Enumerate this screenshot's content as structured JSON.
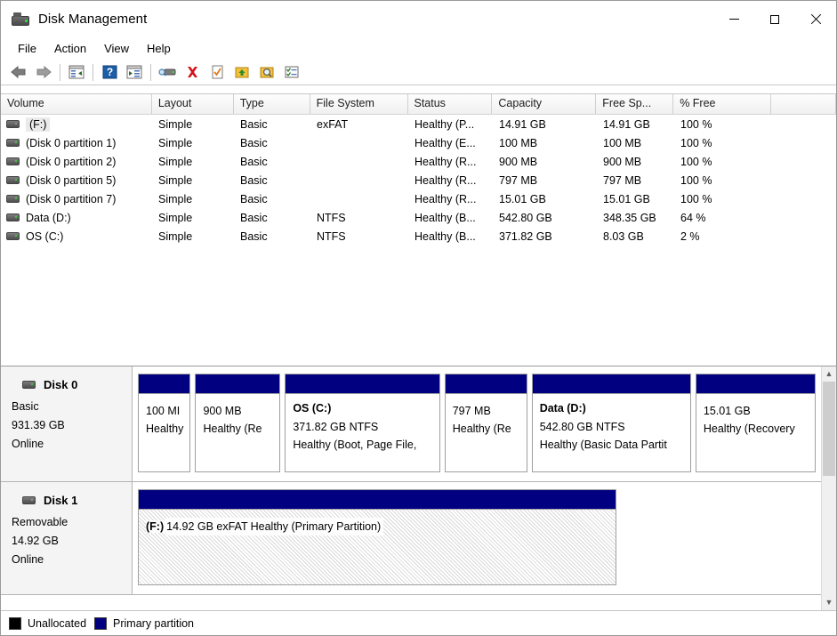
{
  "window": {
    "title": "Disk Management",
    "icon": "disk-management-icon",
    "controls": {
      "minimize": "minimize-icon",
      "maximize": "maximize-icon",
      "close": "close-icon"
    }
  },
  "menubar": {
    "items": [
      {
        "label": "File"
      },
      {
        "label": "Action"
      },
      {
        "label": "View"
      },
      {
        "label": "Help"
      }
    ]
  },
  "toolbar": {
    "buttons": [
      {
        "name": "back-icon"
      },
      {
        "name": "forward-icon"
      },
      {
        "name": "show-hide-console-tree-icon"
      },
      {
        "name": "help-icon"
      },
      {
        "name": "show-hide-action-pane-icon"
      },
      {
        "name": "rescan-disks-icon"
      },
      {
        "name": "delete-volume-icon"
      },
      {
        "name": "properties-icon"
      },
      {
        "name": "extend-volume-icon"
      },
      {
        "name": "search-icon"
      },
      {
        "name": "options-icon"
      }
    ]
  },
  "volume_table": {
    "columns": [
      {
        "label": "Volume",
        "width": 170
      },
      {
        "label": "Layout",
        "width": 92
      },
      {
        "label": "Type",
        "width": 86
      },
      {
        "label": "File System",
        "width": 110
      },
      {
        "label": "Status",
        "width": 95
      },
      {
        "label": "Capacity",
        "width": 117
      },
      {
        "label": "Free Sp...",
        "width": 87
      },
      {
        "label": "% Free",
        "width": 110
      },
      {
        "label": "",
        "width": 73
      }
    ],
    "rows": [
      {
        "volume": "(F:)",
        "layout": "Simple",
        "type": "Basic",
        "file_system": "exFAT",
        "status": "Healthy (P...",
        "capacity": "14.91 GB",
        "free_space": "14.91 GB",
        "percent_free": "100 %",
        "selected": true,
        "icon": "removable-disk-icon"
      },
      {
        "volume": "(Disk 0 partition 1)",
        "layout": "Simple",
        "type": "Basic",
        "file_system": "",
        "status": "Healthy (E...",
        "capacity": "100 MB",
        "free_space": "100 MB",
        "percent_free": "100 %",
        "selected": false,
        "icon": "disk-icon"
      },
      {
        "volume": "(Disk 0 partition 2)",
        "layout": "Simple",
        "type": "Basic",
        "file_system": "",
        "status": "Healthy (R...",
        "capacity": "900 MB",
        "free_space": "900 MB",
        "percent_free": "100 %",
        "selected": false,
        "icon": "disk-icon"
      },
      {
        "volume": "(Disk 0 partition 5)",
        "layout": "Simple",
        "type": "Basic",
        "file_system": "",
        "status": "Healthy (R...",
        "capacity": "797 MB",
        "free_space": "797 MB",
        "percent_free": "100 %",
        "selected": false,
        "icon": "disk-icon"
      },
      {
        "volume": "(Disk 0 partition 7)",
        "layout": "Simple",
        "type": "Basic",
        "file_system": "",
        "status": "Healthy (R...",
        "capacity": "15.01 GB",
        "free_space": "15.01 GB",
        "percent_free": "100 %",
        "selected": false,
        "icon": "disk-icon"
      },
      {
        "volume": "Data (D:)",
        "layout": "Simple",
        "type": "Basic",
        "file_system": "NTFS",
        "status": "Healthy (B...",
        "capacity": "542.80 GB",
        "free_space": "348.35 GB",
        "percent_free": "64 %",
        "selected": false,
        "icon": "disk-icon"
      },
      {
        "volume": "OS (C:)",
        "layout": "Simple",
        "type": "Basic",
        "file_system": "NTFS",
        "status": "Healthy (B...",
        "capacity": "371.82 GB",
        "free_space": "8.03 GB",
        "percent_free": "2 %",
        "selected": false,
        "icon": "disk-icon"
      }
    ]
  },
  "disks": [
    {
      "name": "Disk 0",
      "type": "Basic",
      "size": "931.39 GB",
      "state": "Online",
      "icon": "disk-icon",
      "partitions": [
        {
          "label": "",
          "size": "100 MI",
          "status": "Healthy",
          "flex": 60,
          "selected": false,
          "bar_color": "#000080"
        },
        {
          "label": "",
          "size": "900 MB",
          "status": "Healthy (Re",
          "flex": 98,
          "selected": false,
          "bar_color": "#000080"
        },
        {
          "label": "OS  (C:)",
          "size": "371.82 GB NTFS",
          "status": "Healthy (Boot, Page File,",
          "flex": 180,
          "selected": false,
          "bar_color": "#000080"
        },
        {
          "label": "",
          "size": "797 MB",
          "status": "Healthy (Re",
          "flex": 95,
          "selected": false,
          "bar_color": "#000080"
        },
        {
          "label": "Data  (D:)",
          "size": "542.80 GB NTFS",
          "status": "Healthy (Basic Data Partit",
          "flex": 185,
          "selected": false,
          "bar_color": "#000080"
        },
        {
          "label": "",
          "size": "15.01 GB",
          "status": "Healthy (Recovery",
          "flex": 139,
          "selected": false,
          "bar_color": "#000080"
        }
      ]
    },
    {
      "name": "Disk 1",
      "type": "Removable",
      "size": "14.92 GB",
      "state": "Online",
      "icon": "removable-disk-icon",
      "partitions": [
        {
          "label": "(F:)",
          "size": "14.92 GB exFAT",
          "status": "Healthy (Primary Partition)",
          "flex": 534,
          "selected": true,
          "bar_color": "#000080"
        }
      ]
    }
  ],
  "scrollbar": {
    "up_arrow": "chevron-up-icon",
    "down_arrow": "chevron-down-icon"
  },
  "legend": [
    {
      "label": "Unallocated",
      "color": "#000000"
    },
    {
      "label": "Primary partition",
      "color": "#000080"
    }
  ]
}
